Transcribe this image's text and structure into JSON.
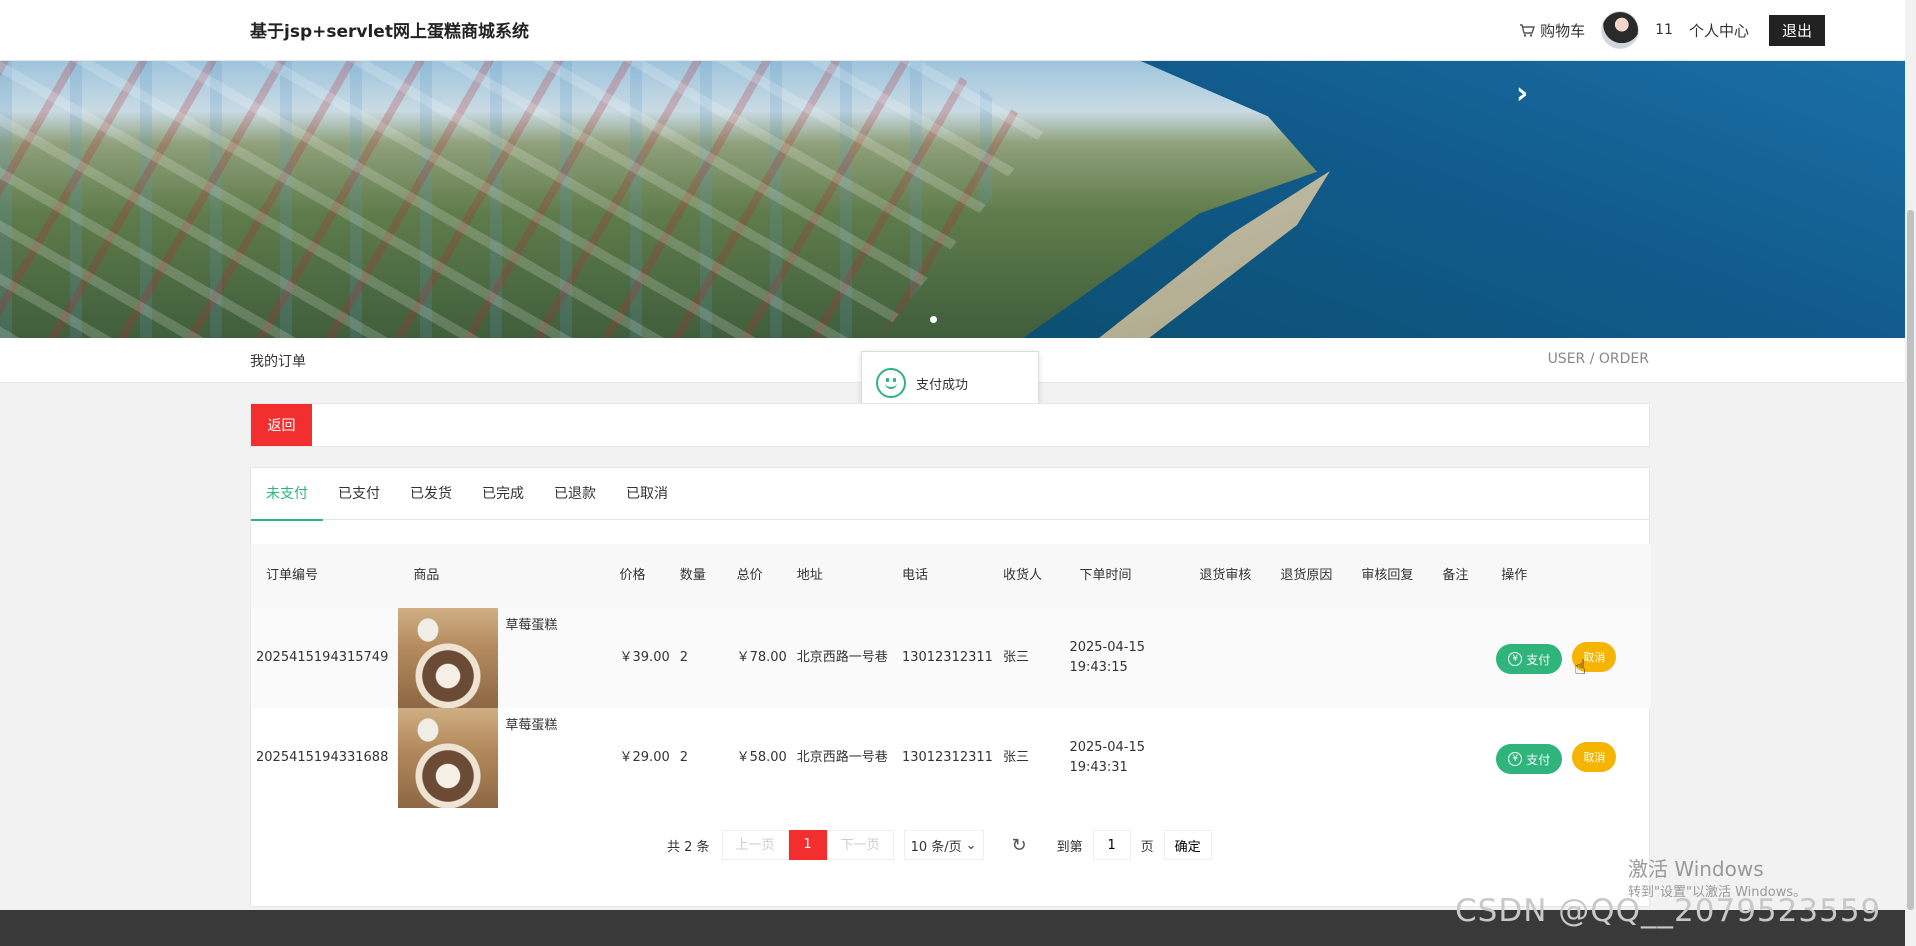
{
  "header": {
    "site_title": "基于jsp+servlet网上蛋糕商城系统",
    "cart_label": "购物车",
    "username": "11",
    "user_center": "个人中心",
    "logout": "退出"
  },
  "banner": {
    "next_icon": "chevron-right-icon"
  },
  "section": {
    "title": "我的订单",
    "subtitle": "USER / ORDER"
  },
  "toast": {
    "message": "支付成功",
    "icon": "smile-icon",
    "color": "#2fb47b"
  },
  "back_button": "返回",
  "tabs": [
    {
      "label": "未支付",
      "active": true
    },
    {
      "label": "已支付"
    },
    {
      "label": "已发货"
    },
    {
      "label": "已完成"
    },
    {
      "label": "已退款"
    },
    {
      "label": "已取消"
    }
  ],
  "table": {
    "headers": {
      "order_no": "订单编号",
      "goods": "商品",
      "price": "价格",
      "qty": "数量",
      "total": "总价",
      "address": "地址",
      "phone": "电话",
      "receiver": "收货人",
      "order_time": "下单时间",
      "refund_review": "退货审核",
      "refund_reason": "退货原因",
      "review_reply": "审核回复",
      "remark": "备注",
      "actions": "操作"
    },
    "rows": [
      {
        "order_no": "2025415194315749",
        "goods_name": "草莓蛋糕",
        "price": "￥39.00",
        "qty": "2",
        "total": "￥78.00",
        "address": "北京西路一号巷",
        "phone": "13012312311",
        "receiver": "张三",
        "order_time": "2025-04-15 19:43:15",
        "pay_label": "支付",
        "cancel_label": "取消"
      },
      {
        "order_no": "2025415194331688",
        "goods_name": "草莓蛋糕",
        "price": "￥29.00",
        "qty": "2",
        "total": "￥58.00",
        "address": "北京西路一号巷",
        "phone": "13012312311",
        "receiver": "张三",
        "order_time": "2025-04-15 19:43:31",
        "pay_label": "支付",
        "cancel_label": "取消"
      }
    ]
  },
  "pagination": {
    "count": "共 2 条",
    "prev": "上一页",
    "current": "1",
    "next": "下一页",
    "page_size": "10 条/页",
    "goto_label": "到第",
    "goto_value": "1",
    "unit": "页",
    "confirm": "确定"
  },
  "watermarks": {
    "windows_line1": "激活 Windows",
    "windows_line2": "转到\"设置\"以激活 Windows。",
    "csdn": "CSDN @QQ__2079523559"
  },
  "colors": {
    "primary": "#2fb47b",
    "danger": "#f22e2e",
    "warning": "#f5b400"
  }
}
